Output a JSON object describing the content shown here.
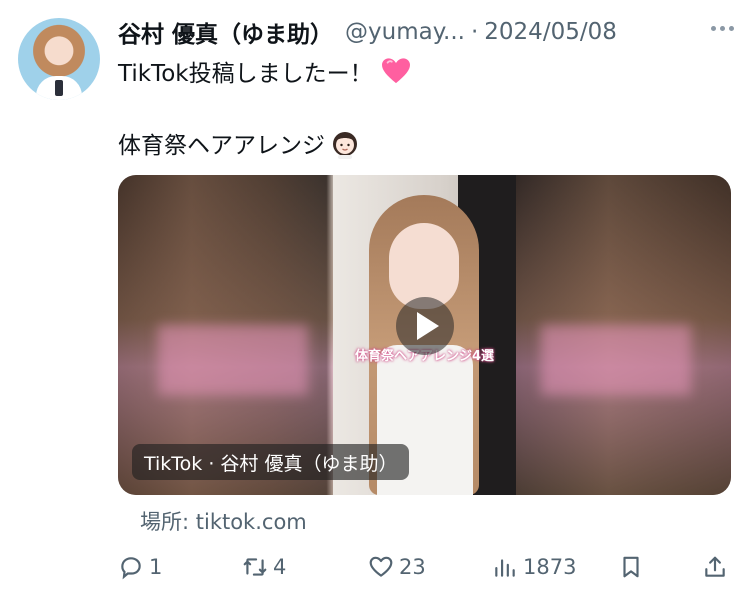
{
  "tweet": {
    "display_name": "谷村 優真（ゆま助）",
    "handle": "@yumay...",
    "separator": "·",
    "date": "2024/05/08",
    "text_line1": "TikTok投稿しましたー！",
    "text_line2": "体育祭ヘアアレンジ",
    "heart_emoji_color": "#ff5fa0"
  },
  "media": {
    "overlay_caption": "体育祭ヘアアレンジ4選",
    "source_label": "TikTok · 谷村 優真（ゆま助）"
  },
  "location": {
    "text": "場所: tiktok.com"
  },
  "actions": {
    "replies": "1",
    "retweets": "4",
    "likes": "23",
    "views": "1873"
  },
  "colors": {
    "text_primary": "#0f1419",
    "text_secondary": "#536471",
    "pink_accent": "#e896b9"
  }
}
